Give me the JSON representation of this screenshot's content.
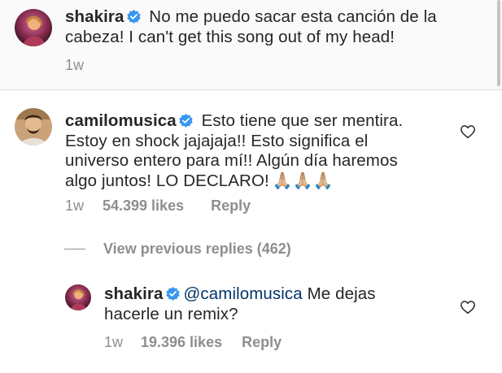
{
  "caption": {
    "username": "shakira",
    "text": "No me puedo sacar esta canción de la cabeza! I can't get this song out of my head!",
    "time": "1w"
  },
  "comment": {
    "username": "camilomusica",
    "text": "Esto tiene que ser mentira. Estoy en shock jajajaja!! Esto significa el universo entero para mí!! Algún día haremos algo juntos! LO DECLARO!",
    "emoji": "🙏🏼🙏🏼🙏🏼",
    "time": "1w",
    "likes": "54.399 likes",
    "reply_label": "Reply"
  },
  "view_previous_replies": "View previous replies (462)",
  "reply": {
    "username": "shakira",
    "mention": "@camilomusica",
    "text": "Me dejas hacerle un remix?",
    "time": "1w",
    "likes": "19.396 likes",
    "reply_label": "Reply"
  },
  "colors": {
    "text": "#262626",
    "secondary": "#8e8e8e",
    "verified_blue": "#3897f0",
    "mention": "#003569",
    "caption_background": "#fafafa"
  },
  "icons": [
    "verified-badge-icon",
    "heart-outline-icon"
  ]
}
